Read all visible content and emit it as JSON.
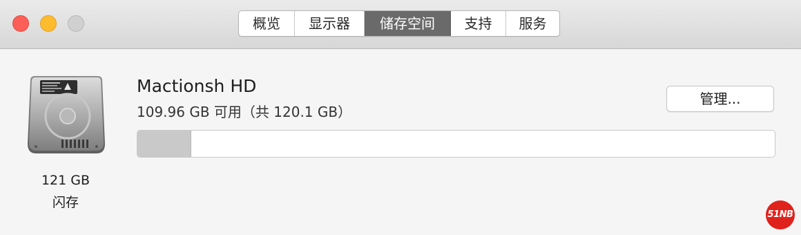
{
  "window": {
    "tabs": [
      {
        "label": "概览",
        "active": false
      },
      {
        "label": "显示器",
        "active": false
      },
      {
        "label": "储存空间",
        "active": true
      },
      {
        "label": "支持",
        "active": false
      },
      {
        "label": "服务",
        "active": false
      }
    ]
  },
  "disk": {
    "name": "Mactionsh HD",
    "availability": "109.96 GB 可用（共 120.1 GB）",
    "capacity": "121 GB",
    "type": "闪存",
    "used_fraction": 0.085,
    "manage_label": "管理..."
  },
  "colors": {
    "tab_active_bg": "#6a6a6a",
    "bar_used": "#c9c9c9",
    "close": "#fc5f57",
    "minimize": "#fdbc2e",
    "zoom_disabled": "#d0d0d0"
  },
  "watermark": "51NB"
}
